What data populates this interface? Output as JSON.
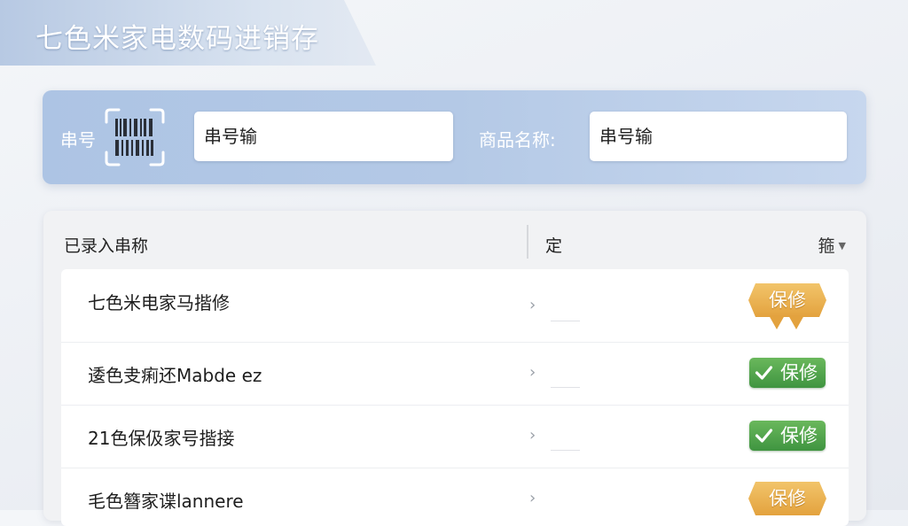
{
  "app": {
    "title": "七色米家电数码进销存"
  },
  "search": {
    "serial_label": "串号",
    "serial_value": "串号输",
    "name_label": "商品名称:",
    "name_value": "串号输"
  },
  "list": {
    "header_left": "已录入串称",
    "header_mid": "定",
    "filter_label": "箍",
    "rows": [
      {
        "name": "七色米电家马揩修",
        "badge": "保修",
        "badge_style": "orange"
      },
      {
        "name": "逶色叏痢还Mabde ez",
        "badge": "保修",
        "badge_style": "green"
      },
      {
        "name": "21色保伋家号揩接",
        "badge": "保修",
        "badge_style": "green"
      },
      {
        "name": "毛色簪家谍lannere",
        "badge": "保修",
        "badge_style": "orange"
      }
    ]
  },
  "colors": {
    "accent": "#adc4e4",
    "badge_orange": "#e3a23e",
    "badge_green": "#4a9e48"
  }
}
